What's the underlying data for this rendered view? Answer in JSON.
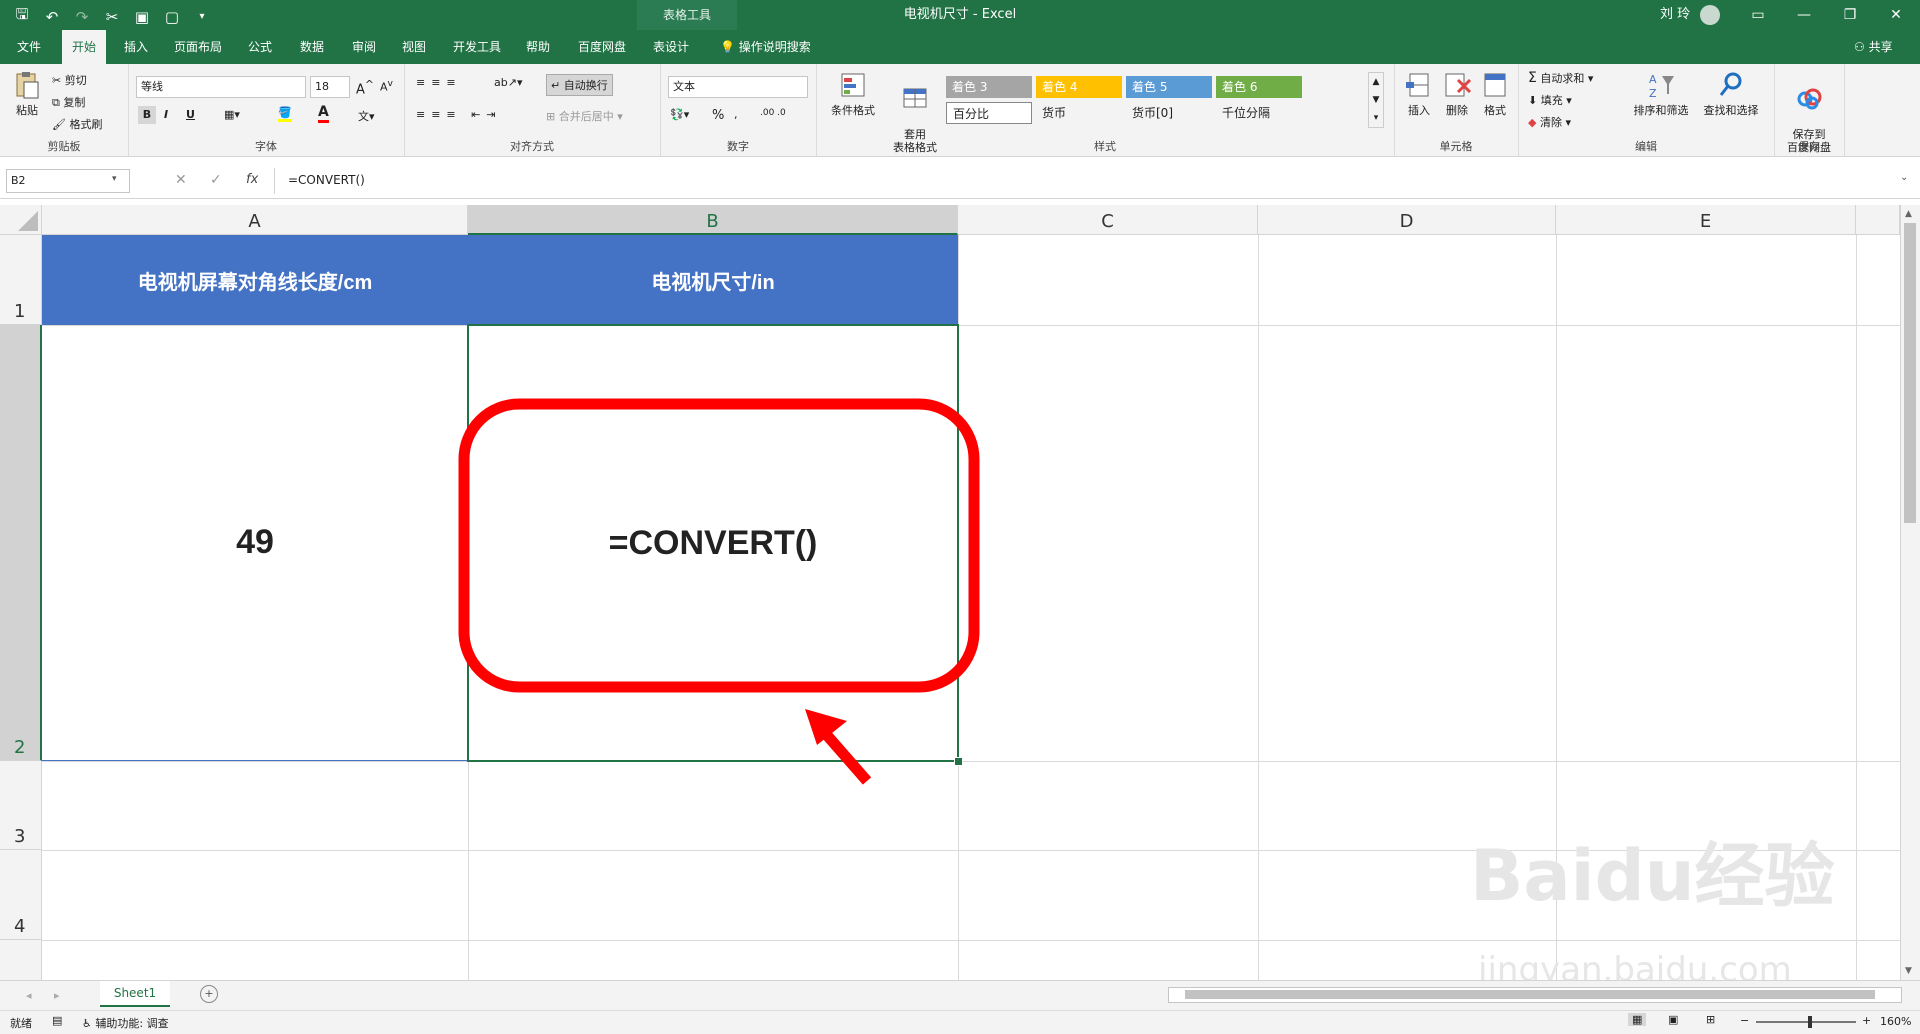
{
  "title_bar": {
    "doc_title": "电视机尺寸 - Excel",
    "context_tools": "表格工具",
    "user_name": "刘 玲",
    "qat_icons": [
      "save-icon",
      "undo-icon",
      "redo-icon",
      "cut-icon",
      "saveas-icon",
      "newdoc-icon",
      "customize-icon"
    ]
  },
  "tabs": [
    "文件",
    "开始",
    "插入",
    "页面布局",
    "公式",
    "数据",
    "审阅",
    "视图",
    "开发工具",
    "帮助",
    "百度网盘",
    "表设计"
  ],
  "active_tab": "开始",
  "search_label": "操作说明搜索",
  "share_label": "共享",
  "ribbon": {
    "clipboard": {
      "paste": "粘贴",
      "cut": "剪切",
      "copy": "复制",
      "format_painter": "格式刷",
      "label": "剪贴板"
    },
    "font": {
      "name": "等线",
      "size": "18",
      "bold": "B",
      "italic": "I",
      "underline": "U",
      "label": "字体"
    },
    "alignment": {
      "wrap": "自动换行",
      "merge": "合并后居中",
      "label": "对齐方式"
    },
    "number": {
      "format": "文本",
      "percent": "%",
      "label": "数字"
    },
    "styles": {
      "conditional": "条件格式",
      "table_format": "套用\n表格格式",
      "cells": [
        {
          "label": "着色 3",
          "color": "#a5a5a5"
        },
        {
          "label": "着色 4",
          "color": "#ffc000"
        },
        {
          "label": "着色 5",
          "color": "#5b9bd5"
        },
        {
          "label": "着色 6",
          "color": "#70ad47"
        },
        {
          "label": "百分比",
          "color": "#ffffff"
        },
        {
          "label": "货币",
          "color": "#ffffff"
        },
        {
          "label": "货币[0]",
          "color": "#ffffff"
        },
        {
          "label": "千位分隔",
          "color": "#ffffff"
        }
      ],
      "label": "样式"
    },
    "cells": {
      "insert": "插入",
      "delete": "删除",
      "format": "格式",
      "label": "单元格"
    },
    "editing": {
      "autosum": "自动求和",
      "fill": "填充",
      "clear": "清除",
      "sort": "排序和筛选",
      "find": "查找和选择",
      "label": "编辑"
    },
    "save": {
      "save_to": "保存到\n百度网盘",
      "label": "保存"
    }
  },
  "formula_bar": {
    "name_box": "B2",
    "formula": "=CONVERT()",
    "fx": "fx"
  },
  "columns": [
    "A",
    "B",
    "C",
    "D",
    "E"
  ],
  "rows": [
    "1",
    "2",
    "3",
    "4"
  ],
  "cells": {
    "A1": "电视机屏幕对角线长度/cm",
    "B1": "电视机尺寸/in",
    "A2": "49",
    "B2": "=CONVERT()"
  },
  "header_fill": "#4472c4",
  "sheet_tab": "Sheet1",
  "status": {
    "ready": "就绪",
    "accessibility": "辅助功能: 调查",
    "zoom": "160%"
  },
  "watermark": {
    "main": "Baidu经验",
    "sub": "jingyan.baidu.com"
  }
}
